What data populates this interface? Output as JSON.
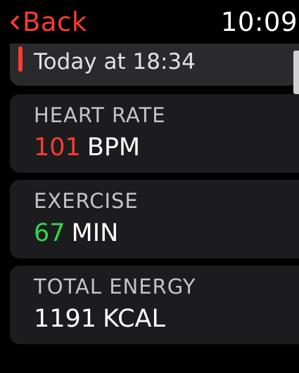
{
  "status_bar": {
    "back_label": "Back",
    "time": "10:09"
  },
  "header": {
    "date": "Today at 18:34",
    "accent_color": "#ff3b30"
  },
  "metrics": [
    {
      "label": "HEART RATE",
      "value": "101",
      "unit": "BPM",
      "value_color": "#ff3b30"
    },
    {
      "label": "EXERCISE",
      "value": "67",
      "unit": "MIN",
      "value_color": "#32d74b"
    },
    {
      "label": "TOTAL ENERGY",
      "value": "1191",
      "unit": "KCAL",
      "value_color": "#ffffff"
    }
  ],
  "icons": {
    "back": "chevron-left-icon"
  }
}
